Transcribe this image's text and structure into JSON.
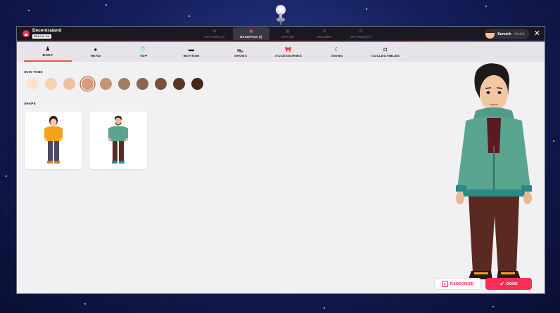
{
  "brand": {
    "name": "Decentraland",
    "realm": "REALM: DG"
  },
  "nav": [
    {
      "icon": "⊙",
      "label": "EXPLORE",
      "shortcut": "(X)",
      "active": false
    },
    {
      "icon": "▣",
      "label": "BACKPACK",
      "shortcut": "(I)",
      "active": true
    },
    {
      "icon": "▤",
      "label": "MAP",
      "shortcut": "(M)",
      "active": false
    },
    {
      "icon": "⚙",
      "label": "BUILDER",
      "shortcut": "",
      "active": false
    },
    {
      "icon": "⚙",
      "label": "SETTINGS",
      "shortcut": "(P)",
      "active": false
    }
  ],
  "user": {
    "name": "Semich",
    "tag": "#bda1"
  },
  "categories": [
    {
      "label": "BODY",
      "icon": "♟",
      "active": true
    },
    {
      "label": "HEAD",
      "icon": "●",
      "active": false
    },
    {
      "label": "TOP",
      "icon": "👕",
      "active": false
    },
    {
      "label": "BOTTOM",
      "icon": "▬",
      "active": false
    },
    {
      "label": "SHOES",
      "icon": "👞",
      "active": false
    },
    {
      "label": "ACCESSORIES",
      "icon": "🎀",
      "active": false
    },
    {
      "label": "SKINS",
      "icon": "☾",
      "active": false
    },
    {
      "label": "COLLECTIBLES",
      "icon": "◘",
      "active": false
    }
  ],
  "skin_tone": {
    "label": "SKIN TONE",
    "colors": [
      "#fde3cb",
      "#f7d1b0",
      "#eebf9a",
      "#d99a76",
      "#c79370",
      "#a37b60",
      "#8c654f",
      "#7b4f3c",
      "#5c3322",
      "#46261a"
    ],
    "selected": 3
  },
  "shape": {
    "label": "SHAPE"
  },
  "buttons": {
    "randomize": "RANDOMIZE",
    "done": "DONE"
  },
  "colors": {
    "accent": "#ff2d55",
    "tab_underline": "#ff4b3a"
  }
}
